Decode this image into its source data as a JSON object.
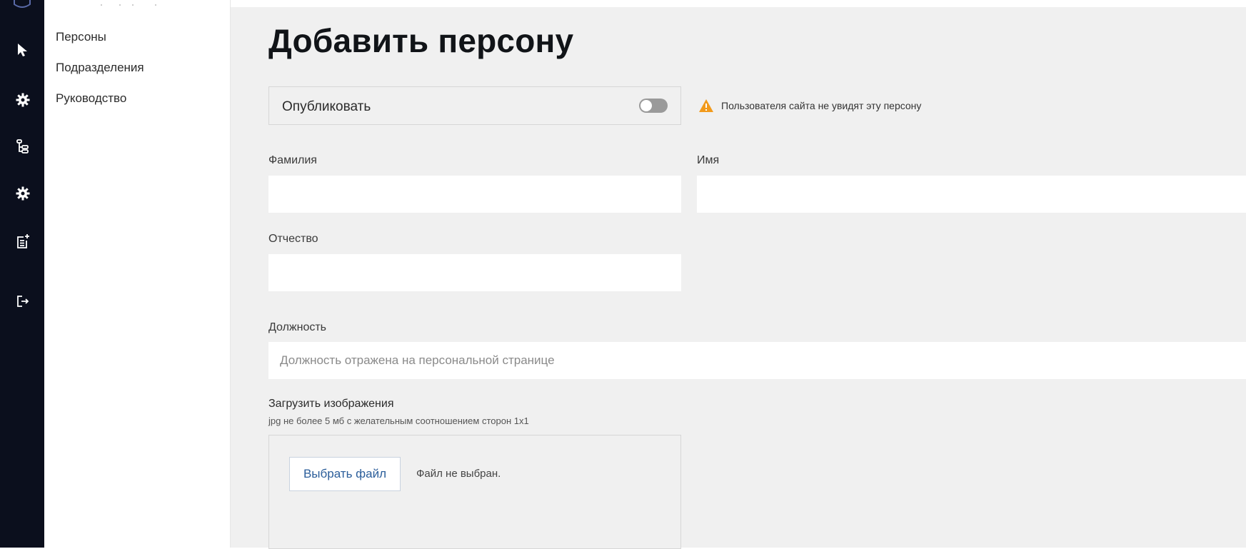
{
  "sidebar": {
    "icons": [
      {
        "name": "pointer-icon"
      },
      {
        "name": "gear-icon"
      },
      {
        "name": "structure-icon"
      },
      {
        "name": "gear-icon"
      },
      {
        "name": "add-document-icon"
      },
      {
        "name": "logout-icon"
      }
    ]
  },
  "submenu": {
    "items": [
      {
        "label": "Персоны"
      },
      {
        "label": "Подразделения"
      },
      {
        "label": "Руководство"
      }
    ]
  },
  "page": {
    "title": "Добавить персону"
  },
  "publish": {
    "label": "Опубликовать",
    "enabled": false,
    "warning": "Пользователя сайта не увидят эту персону"
  },
  "form": {
    "last_name": {
      "label": "Фамилия",
      "value": ""
    },
    "first_name": {
      "label": "Имя",
      "value": ""
    },
    "middle_name": {
      "label": "Отчество",
      "value": ""
    },
    "position": {
      "label": "Должность",
      "value": "",
      "placeholder": "Должность отражена на персональной странице"
    }
  },
  "upload": {
    "title": "Загрузить изображения",
    "hint": "jpg не более 5 мб с желательным соотношением сторон 1x1",
    "button_label": "Выбрать файл",
    "status": "Файл не выбран."
  },
  "colors": {
    "rail": "#0b0f1d",
    "main_bg": "#f0f0f0",
    "warning": "#f29a1b",
    "link": "#2a5d9a"
  }
}
